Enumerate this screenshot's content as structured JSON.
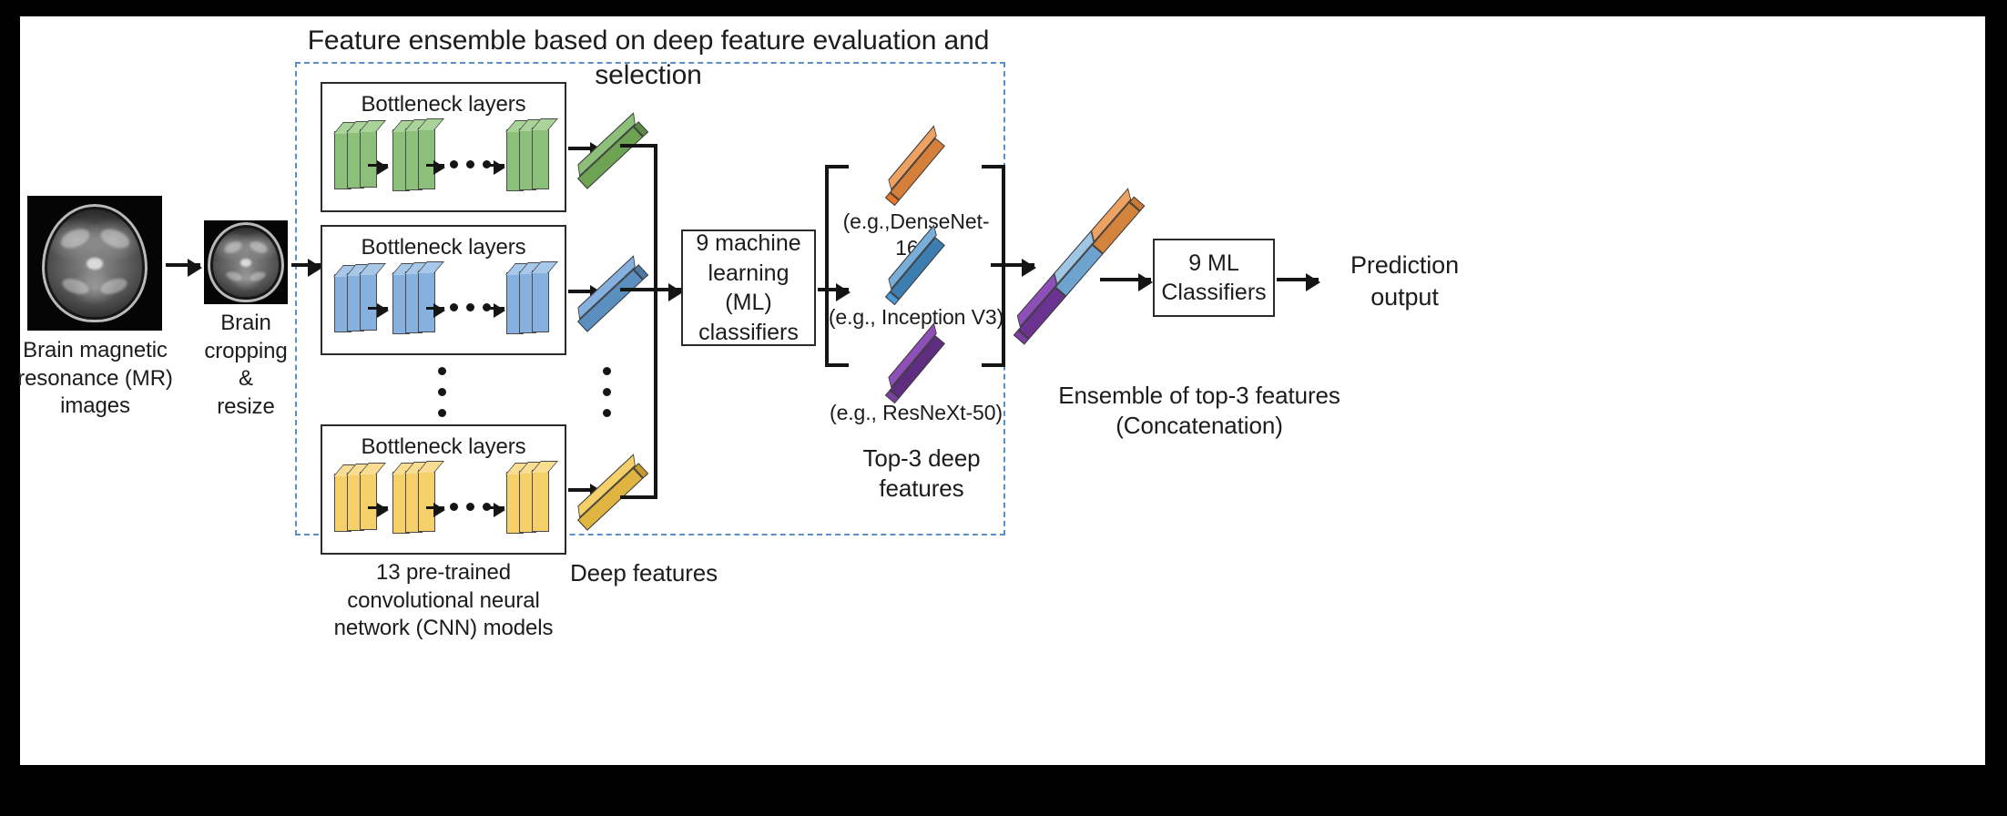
{
  "figure": {
    "title": "Feature ensemble based on deep feature evaluation and selection",
    "domain": "pipeline-diagram"
  },
  "colors": {
    "dashed_border": "#5b8fc9",
    "box_border": "#2b2b2b",
    "arrow": "#151515",
    "green": "#8cc07a",
    "blue": "#86b0dd",
    "gold": "#f4cf6a",
    "orange": "#e08b3f",
    "steel_blue": "#4a90c4",
    "purple": "#7b3fa0",
    "background": "#ffffff",
    "letterbox": "#000000"
  },
  "input_stage": {
    "source_image_label": "Brain magnetic\nresonance (MR)\nimages",
    "crop_image_label": "Brain\ncropping &\nresize",
    "source_image_name": "axial-brain-mri-full",
    "crop_image_name": "axial-brain-mri-cropped"
  },
  "cnn_block": {
    "caption": "13 pre-trained\nconvolutional neural\nnetwork (CNN) models",
    "rows": [
      {
        "title": "Bottleneck layers",
        "color": "green",
        "feature_color": "green"
      },
      {
        "title": "Bottleneck layers",
        "color": "blue",
        "feature_color": "blue"
      },
      {
        "title": "Bottleneck layers",
        "color": "gold",
        "feature_color": "gold"
      }
    ],
    "layer_groups_per_row": 3,
    "slabs_per_group": 3,
    "ellipsis_between_layers": "•••",
    "vertical_ellipsis": "⋮"
  },
  "deep_features": {
    "label": "Deep features"
  },
  "ml_classifiers": {
    "label": "9 machine\nlearning (ML)\nclassifiers"
  },
  "top3": {
    "caption": "Top-3 deep\nfeatures",
    "items": [
      {
        "label": "(e.g.,DenseNet-169)",
        "color": "orange",
        "name": "densenet-169-feature"
      },
      {
        "label": "(e.g., Inception V3)",
        "color": "steel_blue",
        "name": "inception-v3-feature"
      },
      {
        "label": "(e.g., ResNeXt-50)",
        "color": "purple",
        "name": "resnext-50-feature"
      }
    ]
  },
  "ensemble": {
    "caption": "Ensemble of top-3 features\n(Concatenation)",
    "segments": [
      "orange",
      "steel_blue",
      "purple"
    ]
  },
  "final_classifiers": {
    "label": "9 ML\nClassifiers"
  },
  "output": {
    "label": "Prediction\noutput"
  }
}
